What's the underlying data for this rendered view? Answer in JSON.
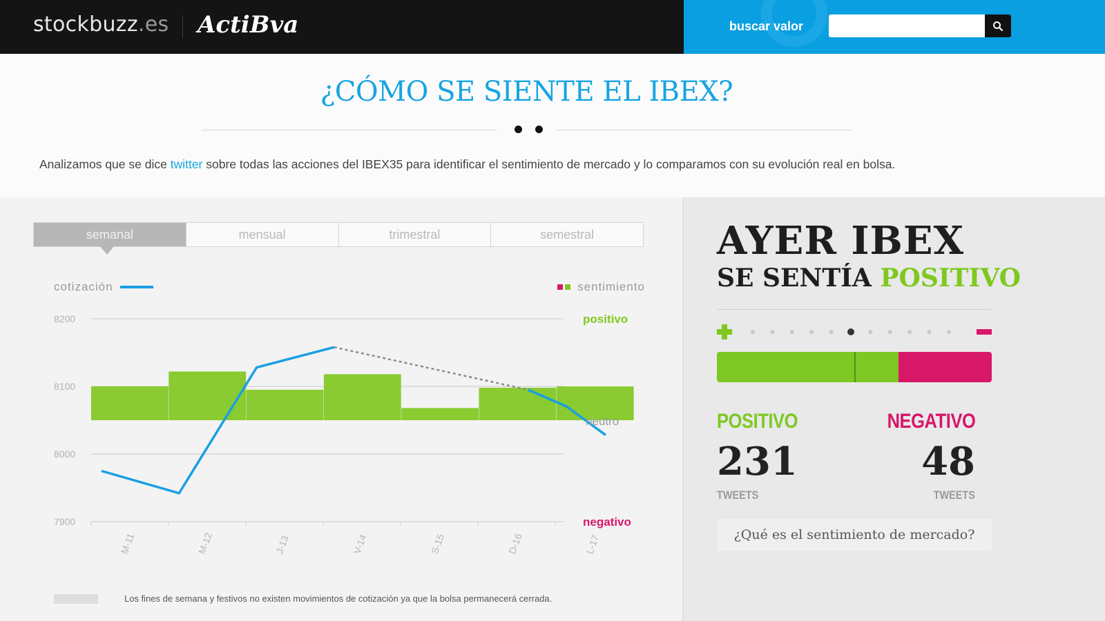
{
  "header": {
    "brand_main": "stockbuzz",
    "brand_tld": ".es",
    "partner": "ActiBva",
    "search_label": "buscar valor",
    "search_value": "",
    "search_icon": "search-icon",
    "colors": {
      "dark": "#141414",
      "accent": "#0a9fe0"
    }
  },
  "hero": {
    "title": "¿CÓMO SE SIENTE EL IBEX?",
    "desc_before": "Analizamos que se dice ",
    "desc_link": "twitter",
    "desc_after": " sobre todas las acciones del IBEX35 para identificar el sentimiento de mercado y lo comparamos con su evolución real en bolsa."
  },
  "tabs": [
    {
      "label": "semanal",
      "active": true
    },
    {
      "label": "mensual",
      "active": false
    },
    {
      "label": "trimestral",
      "active": false
    },
    {
      "label": "semestral",
      "active": false
    }
  ],
  "legend": {
    "cotizacion": "cotización",
    "sentimiento": "sentimiento"
  },
  "chart_data": {
    "type": "line",
    "x": [
      "M-11",
      "M-12",
      "J-13",
      "V-14",
      "S-15",
      "D-16",
      "L-17"
    ],
    "y_ticks": [
      "8200",
      "8100",
      "8000",
      "7900"
    ],
    "ylim": [
      7900,
      8200
    ],
    "series": [
      {
        "name": "cotización",
        "values": [
          7975,
          7942,
          8128,
          8158,
          null,
          null,
          8070,
          8028
        ],
        "color": "#1a9fe3"
      }
    ],
    "line_x": [
      0,
      1,
      2,
      3,
      5.5,
      6,
      6.5
    ],
    "line_y": [
      7975,
      7942,
      8128,
      8158,
      8095,
      8070,
      8028
    ],
    "gap_line": {
      "from_x": 3,
      "from_y": 8158,
      "to_x": 5.5,
      "to_y": 8095
    },
    "sentiment_bars": [
      {
        "top": 8100
      },
      {
        "top": 8122
      },
      {
        "top": 8095
      },
      {
        "top": 8118
      },
      {
        "top": 8068
      },
      {
        "top": 8098
      },
      {
        "top": 8100
      }
    ],
    "sentiment_base": 8050,
    "sentiment_labels": {
      "top": "positivo",
      "middle": "neutro",
      "bottom": "negativo"
    },
    "colors": {
      "positive": "#80c81f",
      "negative": "#d81769",
      "line": "#1a9fe3"
    },
    "grid": true
  },
  "footnote": "Los fines de semana y festivos no existen movimientos de cotización ya que la bolsa permanecerá cerrada.",
  "summary": {
    "line1": "AYER IBEX",
    "line2_prefix": "SE SENTÍA ",
    "line2_state": "POSITIVO",
    "scale_dots": 11,
    "scale_active_dot": 5,
    "positive_share": 0.66,
    "marker_share": 0.5,
    "positive_label": "POSITIVO",
    "negative_label": "NEGATIVO",
    "positive_count": "231",
    "negative_count": "48",
    "unit": "TWEETS",
    "question": "¿Qué es el sentimiento de mercado?"
  }
}
